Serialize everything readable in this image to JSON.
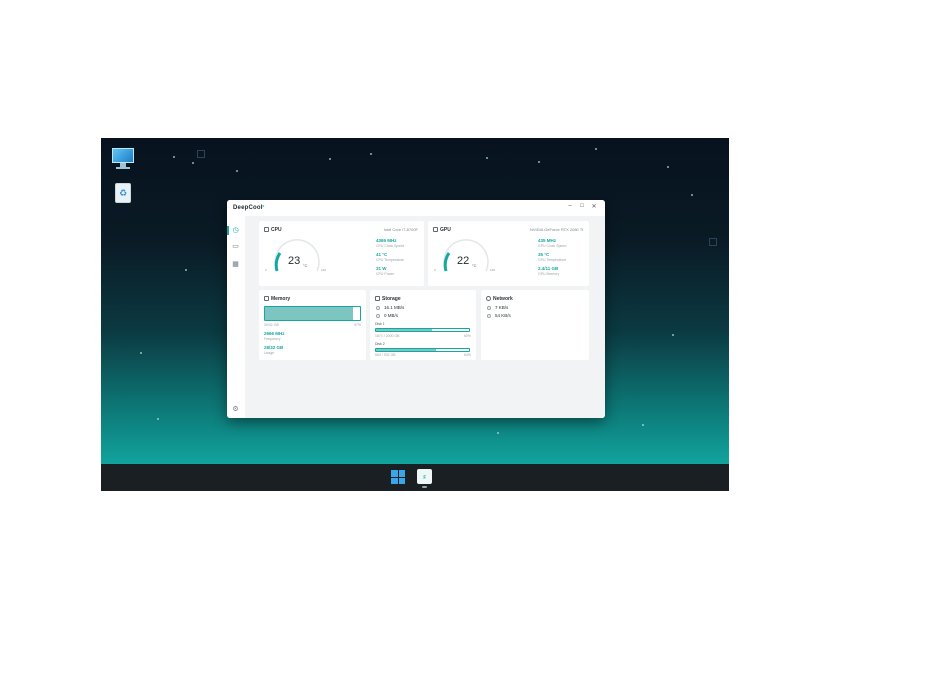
{
  "app": {
    "logo": "DeepCool",
    "window_controls": [
      "–",
      "□",
      "✕"
    ]
  },
  "sidebar": {
    "items": [
      {
        "icon": "dashboard-icon",
        "active": true
      },
      {
        "icon": "monitor-icon",
        "active": false
      },
      {
        "icon": "grid-icon",
        "active": false
      }
    ],
    "settings_icon": "gear-icon"
  },
  "cpu": {
    "title": "CPU",
    "model": "Intel Core i7-8700F",
    "temperature": "23",
    "unit": "°C",
    "gauge_min": "0",
    "gauge_max": "100",
    "clock": {
      "value": "4365 MHz",
      "label": "CPU Clock Speed"
    },
    "temp": {
      "value": "41 °C",
      "label": "CPU Temperature"
    },
    "power": {
      "value": "31 W",
      "label": "CPU Power"
    }
  },
  "gpu": {
    "title": "GPU",
    "model": "NVIDIA GeForce RTX 2080 Ti",
    "temperature": "22",
    "unit": "°C",
    "gauge_min": "0",
    "gauge_max": "100",
    "clock": {
      "value": "435 MHz",
      "label": "GPU Clock Speed"
    },
    "temp": {
      "value": "35 °C",
      "label": "GPU Temperature"
    },
    "memory": {
      "value": "2.4/11 GB",
      "label": "GPU Memory"
    }
  },
  "memory": {
    "title": "Memory",
    "usage_text": "30/32 GB",
    "usage_percent": "97%",
    "usage_fraction": 0.93,
    "frequency": {
      "value": "2666 MHz",
      "label": "Frequency"
    },
    "total": {
      "value": "28/32 GB",
      "label": "Usage"
    }
  },
  "storage": {
    "title": "Storage",
    "read": "16.1 MB/s",
    "write": "0 MB/s",
    "disks": [
      {
        "name": "Disk 1",
        "usage": "1871 / 2000 GB",
        "percent": "60%",
        "fraction": 0.6
      },
      {
        "name": "Disk 2",
        "usage": "564 / 932 GB",
        "percent": "64%",
        "fraction": 0.64
      }
    ]
  },
  "network": {
    "title": "Network",
    "upload": "7 KB/s",
    "download": "54 KB/s"
  }
}
